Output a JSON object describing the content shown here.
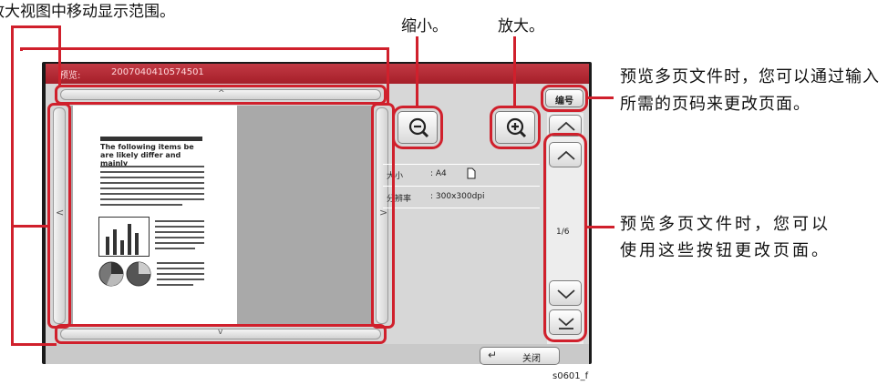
{
  "annotations": {
    "scroll_note": "放大视图中移动显示范围。",
    "zoom_out_note": "缩小。",
    "zoom_in_note": "放大。",
    "page_number_note": "预览多页文件时，您可以通过输入所需的页码来更改页面。",
    "page_buttons_note": "预览多页文件时，您可以使用这些按钮更改页面。"
  },
  "screen": {
    "title_label": "预览:",
    "job_id": "2007040410574501",
    "page_number_button": "编号",
    "close_button": "关闭",
    "page_counter": "1/6",
    "info": {
      "size_label": "大小",
      "size_value": ": A4",
      "resolution_label": "分辨率",
      "resolution_value": ": 300x300dpi"
    }
  },
  "document_preview": {
    "heading": "The following items be are likely differ and mainly"
  },
  "figure_code": "s0601_f"
}
